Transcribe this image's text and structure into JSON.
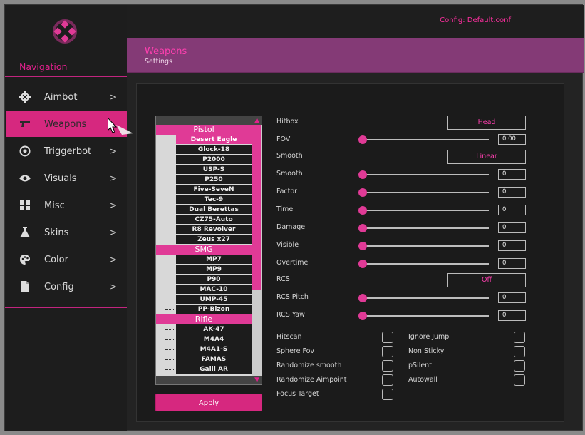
{
  "header": {
    "config_text": "Config: Default.conf"
  },
  "banner": {
    "title": "Weapons",
    "subtitle": "Settings"
  },
  "sidebar": {
    "title": "Navigation",
    "items": [
      {
        "label": "Aimbot",
        "icon": "crosshair-icon",
        "chevron": ">"
      },
      {
        "label": "Weapons",
        "icon": "pistol-icon",
        "chevron": ""
      },
      {
        "label": "Triggerbot",
        "icon": "target-icon",
        "chevron": ">"
      },
      {
        "label": "Visuals",
        "icon": "eye-icon",
        "chevron": ">"
      },
      {
        "label": "Misc",
        "icon": "grid-icon",
        "chevron": ">"
      },
      {
        "label": "Skins",
        "icon": "flask-icon",
        "chevron": ">"
      },
      {
        "label": "Color",
        "icon": "palette-icon",
        "chevron": ">"
      },
      {
        "label": "Config",
        "icon": "file-icon",
        "chevron": ">"
      }
    ],
    "active_index": 1
  },
  "weapons": {
    "categories": [
      {
        "name": "Pistol",
        "items": [
          "Desert Eagle",
          "Glock-18",
          "P2000",
          "USP-S",
          "P250",
          "Five-SeveN",
          "Tec-9",
          "Dual Berettas",
          "CZ75-Auto",
          "R8 Revolver",
          "Zeus x27"
        ]
      },
      {
        "name": "SMG",
        "items": [
          "MP7",
          "MP9",
          "P90",
          "MAC-10",
          "UMP-45",
          "PP-Bizon"
        ]
      },
      {
        "name": "Rifle",
        "items": [
          "AK-47",
          "M4A4",
          "M4A1-S",
          "FAMAS",
          "Galil AR"
        ]
      }
    ],
    "selected": "Desert Eagle",
    "apply_label": "Apply"
  },
  "settings": {
    "hitbox": {
      "label": "Hitbox",
      "value": "Head"
    },
    "fov": {
      "label": "FOV",
      "value": "0.00"
    },
    "smooth_mode": {
      "label": "Smooth",
      "value": "Linear"
    },
    "smooth": {
      "label": "Smooth",
      "value": "0"
    },
    "factor": {
      "label": "Factor",
      "value": "0"
    },
    "time": {
      "label": "Time",
      "value": "0"
    },
    "damage": {
      "label": "Damage",
      "value": "0"
    },
    "visible": {
      "label": "Visible",
      "value": "0"
    },
    "overtime": {
      "label": "Overtime",
      "value": "0"
    },
    "rcs": {
      "label": "RCS",
      "value": "Off"
    },
    "rcs_pitch": {
      "label": "RCS Pitch",
      "value": "0"
    },
    "rcs_yaw": {
      "label": "RCS Yaw",
      "value": "0"
    }
  },
  "checkboxes": {
    "hitscan": "Hitscan",
    "sphere_fov": "Sphere Fov",
    "randomize_smooth": "Randomize smooth",
    "randomize_aimpoint": "Randomize Aimpoint",
    "focus_target": "Focus Target",
    "ignore_jump": "Ignore Jump",
    "non_sticky": "Non Sticky",
    "psilent": "pSilent",
    "autowall": "Autowall"
  },
  "colors": {
    "accent": "#e03a96",
    "banner": "#843a76",
    "background": "#232323"
  }
}
